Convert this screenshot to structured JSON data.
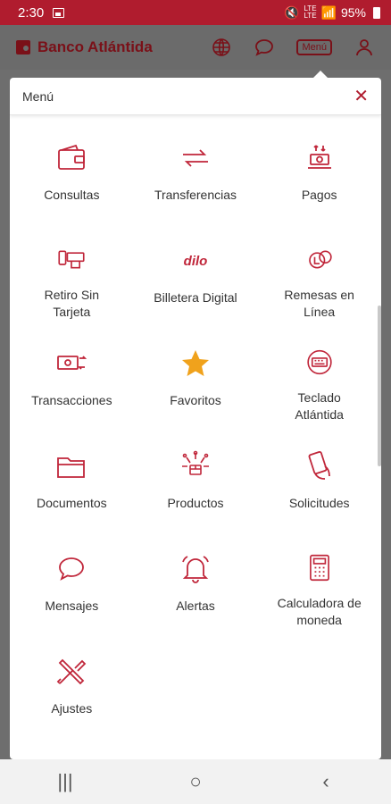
{
  "status_bar": {
    "time": "2:30",
    "network_top": "LTE",
    "network_bottom": "LTE",
    "battery": "95%"
  },
  "app_bar": {
    "brand": "Banco Atlántida",
    "menu_label": "Menú"
  },
  "menu_panel": {
    "title": "Menú",
    "close_label": "✕",
    "items": [
      {
        "label": "Consultas",
        "icon": "wallet-icon"
      },
      {
        "label": "Transferencias",
        "icon": "arrows-exchange-icon"
      },
      {
        "label": "Pagos",
        "icon": "payment-icon"
      },
      {
        "label": "Retiro Sin\nTarjeta",
        "icon": "cardless-withdraw-icon"
      },
      {
        "label": "Billetera Digital",
        "icon": "dilo-logo-icon",
        "logo_text": "dilo"
      },
      {
        "label": "Remesas en\nLínea",
        "icon": "remittance-globe-icon"
      },
      {
        "label": "Transacciones",
        "icon": "transactions-icon"
      },
      {
        "label": "Favoritos",
        "icon": "star-icon"
      },
      {
        "label": "Teclado\nAtlántida",
        "icon": "keyboard-icon"
      },
      {
        "label": "Documentos",
        "icon": "folder-icon"
      },
      {
        "label": "Productos",
        "icon": "products-icon"
      },
      {
        "label": "Solicitudes",
        "icon": "phone-hand-icon"
      },
      {
        "label": "Mensajes",
        "icon": "chat-icon"
      },
      {
        "label": "Alertas",
        "icon": "bell-icon"
      },
      {
        "label": "Calculadora de\nmoneda",
        "icon": "calculator-icon"
      },
      {
        "label": "Ajustes",
        "icon": "tools-icon"
      }
    ]
  },
  "nav_bar": {
    "recents": "|||",
    "home": "○",
    "back": "‹"
  },
  "colors": {
    "brand_red": "#b01c2e",
    "dark_red": "#7a1018",
    "star": "#f0a21c",
    "icon_red": "#c0263a"
  }
}
